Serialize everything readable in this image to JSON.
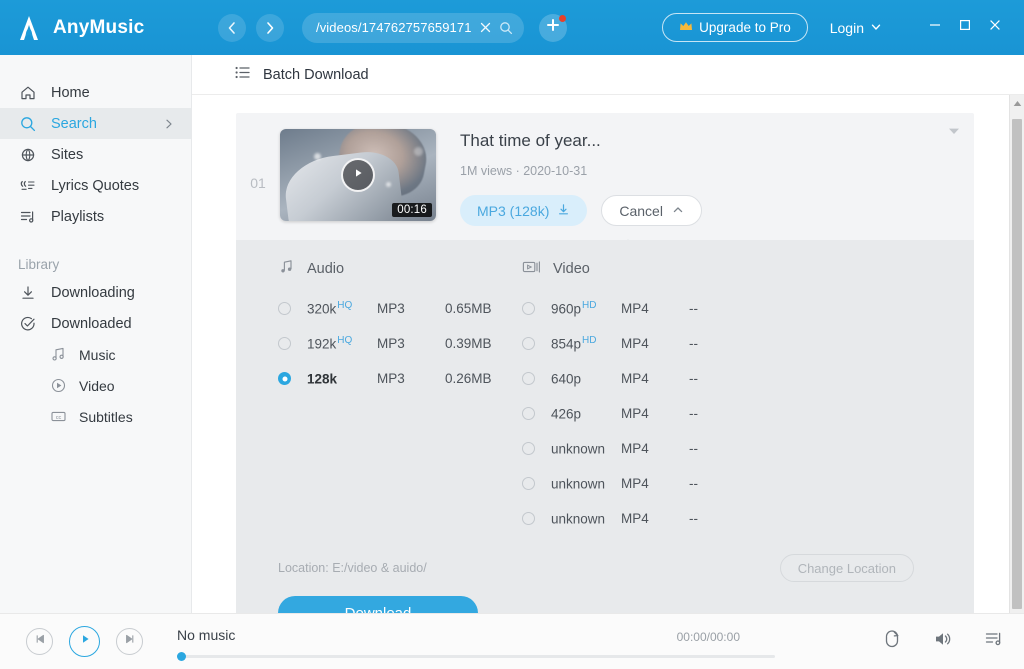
{
  "titlebar": {
    "brand": "AnyMusic",
    "back_icon": "chevron-left-icon",
    "forward_icon": "chevron-right-icon",
    "url_value": "/videos/174762757659171",
    "url_clear_icon": "close-icon",
    "url_search_icon": "search-icon",
    "add_icon": "plus-icon",
    "upgrade_label": "Upgrade to Pro",
    "upgrade_icon": "crown-icon",
    "login_label": "Login",
    "login_chevron_icon": "chevron-down-icon",
    "minimize_icon": "minimize-icon",
    "maximize_icon": "maximize-icon",
    "close_icon": "close-icon"
  },
  "sidebar": {
    "items": [
      {
        "label": "Home",
        "icon": "home-icon"
      },
      {
        "label": "Search",
        "icon": "search-icon"
      },
      {
        "label": "Sites",
        "icon": "globe-icon"
      },
      {
        "label": "Lyrics Quotes",
        "icon": "quote-icon"
      },
      {
        "label": "Playlists",
        "icon": "playlist-icon"
      }
    ],
    "section_label": "Library",
    "library": [
      {
        "label": "Downloading",
        "icon": "download-icon"
      },
      {
        "label": "Downloaded",
        "icon": "check-circle-icon"
      }
    ],
    "sub_items": [
      {
        "label": "Music",
        "icon": "music-note-icon"
      },
      {
        "label": "Video",
        "icon": "play-circle-icon"
      },
      {
        "label": "Subtitles",
        "icon": "cc-icon"
      }
    ]
  },
  "main": {
    "header_label": "Batch Download",
    "header_icon": "list-icon"
  },
  "card": {
    "index": "01",
    "duration": "00:16",
    "play_icon": "play-icon",
    "title": "That time of year...",
    "subtitle": "1M views · 2020-10-31",
    "format_button": "MP3 (128k)",
    "format_button_icon": "download-icon",
    "cancel_button": "Cancel",
    "cancel_chevron_icon": "chevron-up-icon",
    "collapse_icon": "caret-down-icon"
  },
  "panel": {
    "audio_header": "Audio",
    "audio_icon": "music-note-icon",
    "video_header": "Video",
    "video_icon": "video-camera-icon",
    "audio_options": [
      {
        "quality": "320k",
        "badge": "HQ",
        "format": "MP3",
        "size": "0.65MB",
        "selected": false
      },
      {
        "quality": "192k",
        "badge": "HQ",
        "format": "MP3",
        "size": "0.39MB",
        "selected": false
      },
      {
        "quality": "128k",
        "badge": "",
        "format": "MP3",
        "size": "0.26MB",
        "selected": true
      }
    ],
    "video_options": [
      {
        "quality": "960p",
        "badge": "HD",
        "format": "MP4",
        "size": "--",
        "selected": false
      },
      {
        "quality": "854p",
        "badge": "HD",
        "format": "MP4",
        "size": "--",
        "selected": false
      },
      {
        "quality": "640p",
        "badge": "",
        "format": "MP4",
        "size": "--",
        "selected": false
      },
      {
        "quality": "426p",
        "badge": "",
        "format": "MP4",
        "size": "--",
        "selected": false
      },
      {
        "quality": "unknown",
        "badge": "",
        "format": "MP4",
        "size": "--",
        "selected": false
      },
      {
        "quality": "unknown",
        "badge": "",
        "format": "MP4",
        "size": "--",
        "selected": false
      },
      {
        "quality": "unknown",
        "badge": "",
        "format": "MP4",
        "size": "--",
        "selected": false
      }
    ],
    "location_label": "Location: E:/video & auido/",
    "change_location_label": "Change Location",
    "download_label": "Download"
  },
  "player": {
    "prev_icon": "skip-previous-icon",
    "play_icon": "play-icon",
    "next_icon": "skip-next-icon",
    "track_title": "No music",
    "time": "00:00/00:00",
    "repeat_icon": "repeat-icon",
    "volume_icon": "volume-icon",
    "queue_icon": "playlist-queue-icon"
  },
  "colors": {
    "accent": "#2ba7e0",
    "titlebar": "#1d9bd8",
    "panel_bg": "#e8eaec",
    "card_bg": "#f3f4f6",
    "sidebar_bg": "#f7f8f9",
    "badge_hq": "#4aa8df"
  },
  "scrollbar": {
    "up_icon": "caret-up-icon",
    "down_icon": "caret-down-icon"
  }
}
